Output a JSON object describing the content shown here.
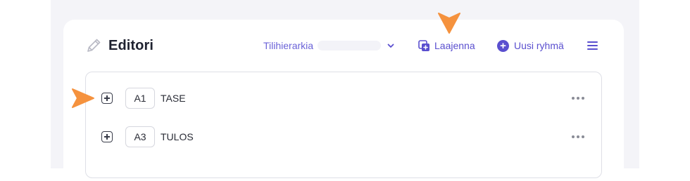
{
  "header": {
    "title": "Editori",
    "title_icon": "pencil-icon",
    "hierarchy_label": "Tilihierarkia",
    "expand_label": "Laajenna",
    "new_group_label": "Uusi ryhmä"
  },
  "rows": [
    {
      "code": "A1",
      "name": "TASE"
    },
    {
      "code": "A3",
      "name": "TULOS"
    }
  ],
  "colors": {
    "accent": "#5a4fcf",
    "arrow": "#f5923e",
    "text": "#2a2c36"
  }
}
